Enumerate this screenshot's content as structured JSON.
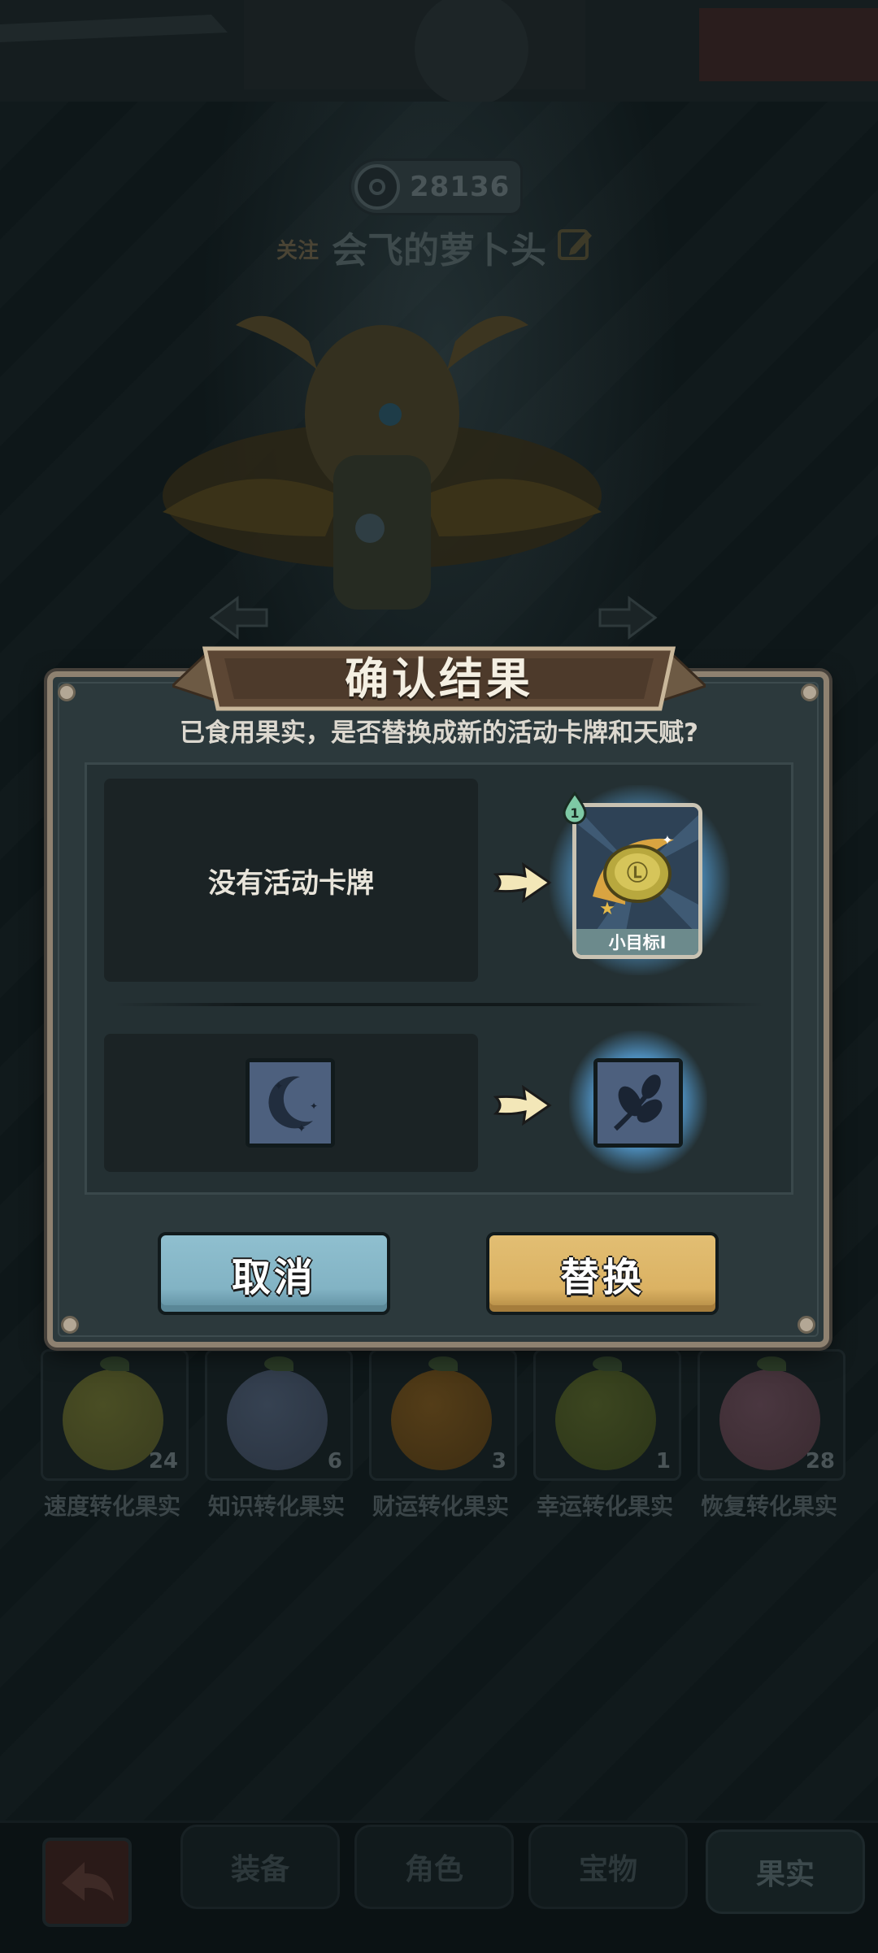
{
  "profile": {
    "power": "28136",
    "follow_label": "关注",
    "player_name": "会飞的萝卜头"
  },
  "dialog": {
    "title": "确认结果",
    "subtitle": "已食用果实，是否替换成新的活动卡牌和天赋?",
    "current_card_text": "没有活动卡牌",
    "new_card": {
      "name": "小目标I",
      "level": "1"
    },
    "current_talent_icon": "moon-icon",
    "new_talent_icon": "leaf-sprig-icon",
    "cancel_label": "取消",
    "replace_label": "替换"
  },
  "fruits": [
    {
      "label": "速度转化果实",
      "count": "24",
      "color": "#3a3d1e"
    },
    {
      "label": "知识转化果实",
      "count": "6",
      "color": "#2a3340"
    },
    {
      "label": "财运转化果实",
      "count": "3",
      "color": "#3d2d12"
    },
    {
      "label": "幸运转化果实",
      "count": "1",
      "color": "#2c3518"
    },
    {
      "label": "恢复转化果实",
      "count": "28",
      "color": "#3a2a30"
    }
  ],
  "tabs": [
    {
      "label": "装备",
      "active": false
    },
    {
      "label": "角色",
      "active": false
    },
    {
      "label": "宝物",
      "active": false
    },
    {
      "label": "果实",
      "active": true
    }
  ],
  "colors": {
    "cancel_button": "#82b3c4",
    "replace_button": "#dbb263",
    "dialog_border": "#8e8170",
    "card_glow": "#8fd0ff"
  }
}
